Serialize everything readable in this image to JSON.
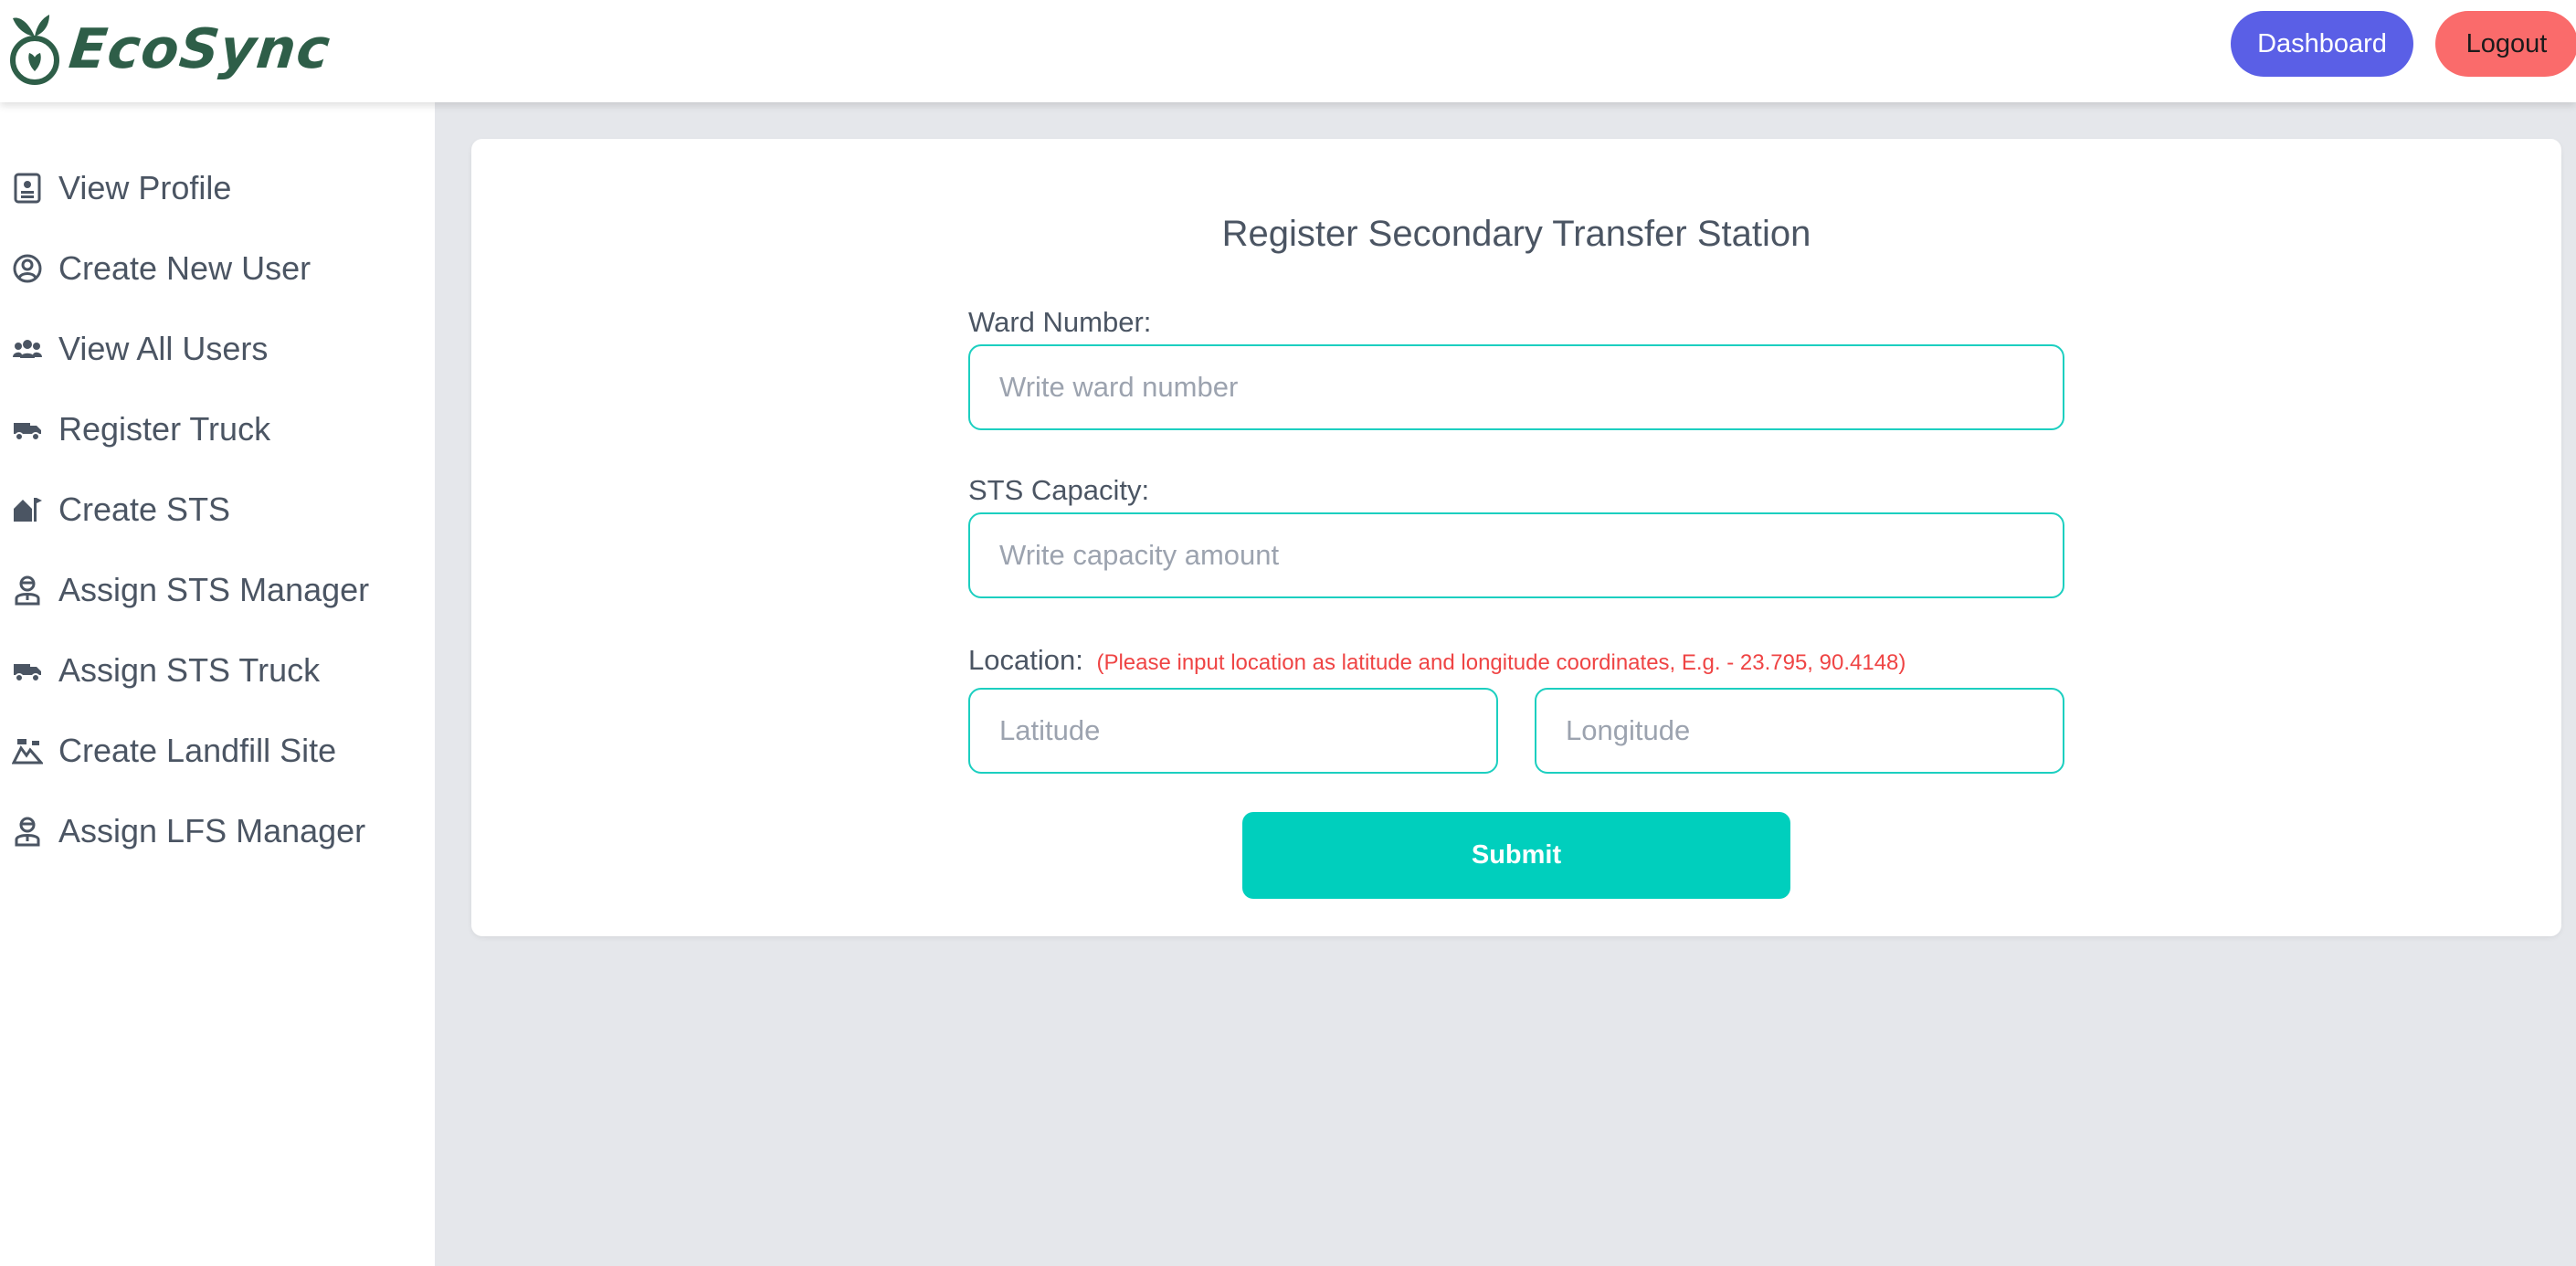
{
  "brand": {
    "name": "EcoSync",
    "color": "#2e5e48"
  },
  "header": {
    "dashboard_label": "Dashboard",
    "logout_label": "Logout",
    "dashboard_color": "#5a5fe6",
    "logout_color": "#fa6b6b"
  },
  "sidebar": {
    "items": [
      {
        "label": "View Profile",
        "icon": "profile-card-icon"
      },
      {
        "label": "Create New User",
        "icon": "user-circle-icon"
      },
      {
        "label": "View All Users",
        "icon": "users-group-icon"
      },
      {
        "label": "Register Truck",
        "icon": "truck-icon"
      },
      {
        "label": "Create STS",
        "icon": "station-flag-icon"
      },
      {
        "label": "Assign STS Manager",
        "icon": "manager-icon"
      },
      {
        "label": "Assign STS Truck",
        "icon": "truck-icon"
      },
      {
        "label": "Create Landfill Site",
        "icon": "landfill-icon"
      },
      {
        "label": "Assign LFS Manager",
        "icon": "manager-icon"
      }
    ]
  },
  "form": {
    "title": "Register Secondary Transfer Station",
    "ward_label": "Ward Number:",
    "ward_placeholder": "Write ward number",
    "capacity_label": "STS Capacity:",
    "capacity_placeholder": "Write capacity amount",
    "location_label": "Location:",
    "location_hint": "(Please input location as latitude and longitude coordinates, E.g. - 23.795, 90.4148)",
    "latitude_placeholder": "Latitude",
    "longitude_placeholder": "Longitude",
    "submit_label": "Submit",
    "accent_color": "#00cfbd"
  }
}
